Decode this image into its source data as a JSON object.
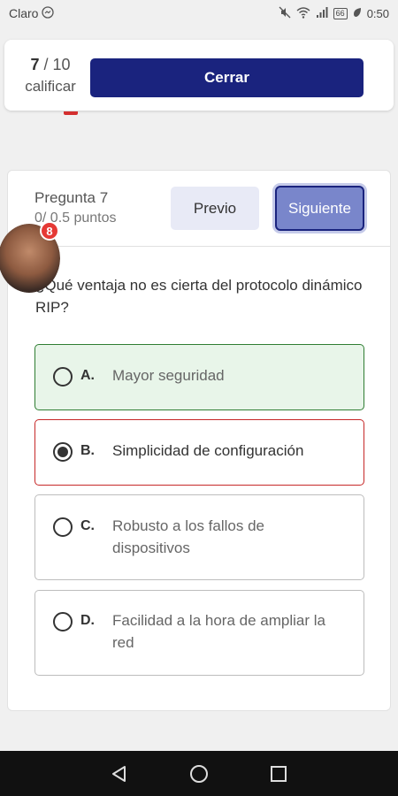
{
  "status_bar": {
    "carrier": "Claro",
    "battery": "66",
    "time": "0:50"
  },
  "top": {
    "progress_current": "7",
    "progress_total": "/ 10",
    "progress_label": "calificar",
    "close_label": "Cerrar"
  },
  "question": {
    "title": "Pregunta 7",
    "points": "0/ 0.5 puntos",
    "prev_label": "Previo",
    "next_label": "Siguiente",
    "text": "¿Qué ventaja no es cierta del protocolo dinámico RIP?",
    "options": [
      {
        "letter": "A.",
        "text": "Mayor seguridad"
      },
      {
        "letter": "B.",
        "text": "Simplicidad de configuración"
      },
      {
        "letter": "C.",
        "text": "Robusto a los fallos de dispositivos"
      },
      {
        "letter": "D.",
        "text": "Facilidad a la hora de ampliar la red"
      }
    ]
  },
  "chat_head": {
    "badge_count": "8"
  },
  "colors": {
    "primary": "#1a237e",
    "next_button": "#7986cb",
    "correct_bg": "#e8f5e9",
    "correct_border": "#2e7d32",
    "wrong_border": "#c62828",
    "badge": "#e53935"
  },
  "icons": {
    "nav_back": "triangle-back-icon",
    "nav_home": "circle-home-icon",
    "nav_recents": "square-recents-icon"
  }
}
